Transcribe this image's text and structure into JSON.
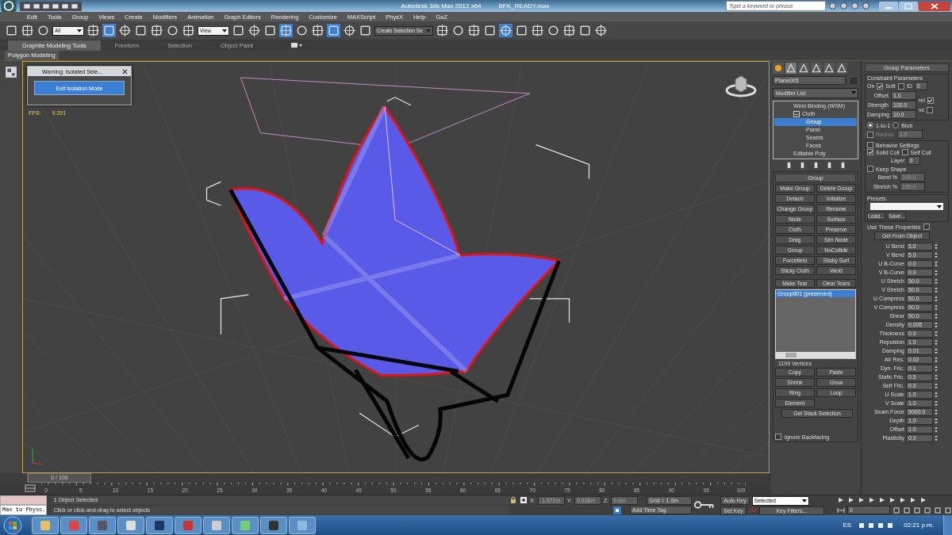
{
  "title_bar": {
    "app_title": "Autodesk 3ds Max  2012 x64",
    "file_name": "BFK_READY.max",
    "search": {
      "placeholder": "Type a keyword or phrase"
    }
  },
  "menu_bar": [
    "Edit",
    "Tools",
    "Group",
    "Views",
    "Create",
    "Modifiers",
    "Animation",
    "Graph Editors",
    "Rendering",
    "Customize",
    "MAXScript",
    "PhysX",
    "Help",
    "GoZ"
  ],
  "toolbar": {
    "selection_filter": "All",
    "reference_coord": "View",
    "named_selection": "Create Selection Se"
  },
  "ribbon": {
    "tabs": [
      {
        "label": "Graphite Modeling Tools",
        "selected": true
      },
      {
        "label": "Freeform",
        "selected": false
      },
      {
        "label": "Selection",
        "selected": false
      },
      {
        "label": "Object Paint",
        "selected": false
      }
    ],
    "panel_label": "Polygon Modeling"
  },
  "viewport": {
    "fps_label": "FPS:",
    "fps_value": "9.291",
    "dialog": {
      "title": "Warning: Isolated Sele...",
      "button": "Exit Isolation Mode"
    }
  },
  "modify_panel": {
    "object_name": "Plane005",
    "modifier_list": "Modifier List",
    "stack": [
      {
        "label": "Wind Binding (WSM)",
        "selected": false
      },
      {
        "label": "Cloth",
        "selected": false,
        "expanded": true,
        "children": [
          {
            "label": "Group",
            "selected": true
          },
          {
            "label": "Panel",
            "selected": false
          },
          {
            "label": "Seams",
            "selected": false
          },
          {
            "label": "Faces",
            "selected": false
          }
        ]
      },
      {
        "label": "Editable Poly",
        "selected": false
      }
    ]
  },
  "group_rollout": {
    "title": "Group",
    "buttons": [
      "Make Group",
      "Delete Group",
      "Detach",
      "Initialize",
      "Change Group",
      "Rename",
      "Node",
      "Surface",
      "Cloth",
      "Preserve",
      "Drag",
      "Sim Node",
      "Group",
      "NoCollide",
      "Forcefield",
      "Sticky Surf",
      "Sticky Cloth",
      "Weld"
    ],
    "tear_buttons": [
      "Make Tear",
      "Clear Tears"
    ],
    "groups": [
      {
        "label": "Group001 (preserved)",
        "selected": true
      }
    ],
    "vertex_count": "1199 Vertices",
    "selection_buttons": [
      "Copy",
      "Paste",
      "Shrink",
      "Grow",
      "Ring",
      "Loop",
      "Element"
    ],
    "stack_button": "Get Stack Selection",
    "ignore_backfacing": {
      "label": "Ignore Backfacing",
      "checked": false
    }
  },
  "group_parameters": {
    "title": "Group Parameters",
    "constraint_title": "Constraint Parameters",
    "on": {
      "label": "On",
      "checked": true
    },
    "soft": {
      "label": "Soft",
      "checked": false
    },
    "id": {
      "label": "ID",
      "value": "0"
    },
    "offset": {
      "label": "Offset",
      "value": "1.0"
    },
    "strength": {
      "label": "Strength",
      "value": "100.0"
    },
    "damping": {
      "label": "Damping",
      "value": "10.0"
    },
    "rel": {
      "label": "rel",
      "checked": true
    },
    "vc": {
      "label": "vc",
      "checked": false
    },
    "mode": [
      {
        "label": "1-to-1",
        "selected": true
      },
      {
        "label": "Blob",
        "selected": false
      }
    ],
    "radius": {
      "label": "Radius:",
      "value": "2.0",
      "checked": false,
      "disabled": true
    },
    "behavior": {
      "label": "Behavior Settings",
      "checked": false
    },
    "solid_coll": {
      "label": "Solid Coll",
      "checked": true
    },
    "self_coll": {
      "label": "Self Coll",
      "checked": false
    },
    "layer": {
      "label": "Layer",
      "value": "0"
    },
    "keep_shape": {
      "label": "Keep Shape",
      "checked": false
    },
    "bend": {
      "label": "Bend %",
      "value": "100.0",
      "disabled": true
    },
    "stretch": {
      "label": "Stretch %",
      "value": "100.0",
      "disabled": true
    },
    "presets_title": "Presets",
    "load": "Load...",
    "save": "Save...",
    "use_props": {
      "label": "Use These Properties",
      "checked": false
    },
    "get_from": "Get From Object",
    "params": [
      {
        "label": "U Bend",
        "value": "5.0"
      },
      {
        "label": "V Bend",
        "value": "5.0"
      },
      {
        "label": "U B-Curve",
        "value": "0.0"
      },
      {
        "label": "V B-Curve",
        "value": "0.0"
      },
      {
        "label": "U Stretch",
        "value": "50.0"
      },
      {
        "label": "V Stretch",
        "value": "50.0"
      },
      {
        "label": "U Compress",
        "value": "50.0"
      },
      {
        "label": "V Compress",
        "value": "50.0"
      },
      {
        "label": "Shear",
        "value": "50.0"
      },
      {
        "label": "Density",
        "value": "0.005"
      },
      {
        "label": "Thickness",
        "value": "0.0"
      },
      {
        "label": "Repulsion",
        "value": "1.0"
      },
      {
        "label": "Damping",
        "value": "0.01"
      },
      {
        "label": "Air Res.",
        "value": "0.02"
      },
      {
        "label": "Dyn. Fric.",
        "value": "0.1"
      },
      {
        "label": "Static Fric.",
        "value": "0.5"
      },
      {
        "label": "Self Fric.",
        "value": "0.0"
      },
      {
        "label": "U Scale",
        "value": "1.0"
      },
      {
        "label": "V Scale",
        "value": "1.0"
      },
      {
        "label": "Seam Force",
        "value": "5000.0"
      },
      {
        "label": "Depth",
        "value": "1.0"
      },
      {
        "label": "Offset",
        "value": "1.0"
      },
      {
        "label": "Plasticity",
        "value": "0.0"
      }
    ]
  },
  "timeline": {
    "frame_counter": "0 / 100",
    "level": 0,
    "ticks": [
      "0",
      "5",
      "10",
      "15",
      "20",
      "25",
      "30",
      "35",
      "40",
      "45",
      "50",
      "55",
      "60",
      "65",
      "70",
      "75",
      "80",
      "85",
      "90",
      "95",
      "100"
    ]
  },
  "status": {
    "maxscript": "Max to Physc.",
    "selected_text": "1 Object Selected",
    "prompt": "Click or click-and-drag to select objects",
    "coords": [
      {
        "label": "X:",
        "value": "-1.572m"
      },
      {
        "label": "Y:",
        "value": "0.638m"
      },
      {
        "label": "Z:",
        "value": "0.0m"
      }
    ],
    "grid": "Grid = 1.0m",
    "time_tag": "Add Time Tag",
    "auto_key": "Auto Key",
    "key_mode": "Selected",
    "set_key": "Set Key",
    "key_filters": "Key Filters...",
    "frame": "0"
  },
  "taskbar": {
    "language": "ES",
    "clock": "02:21 p.m."
  }
}
